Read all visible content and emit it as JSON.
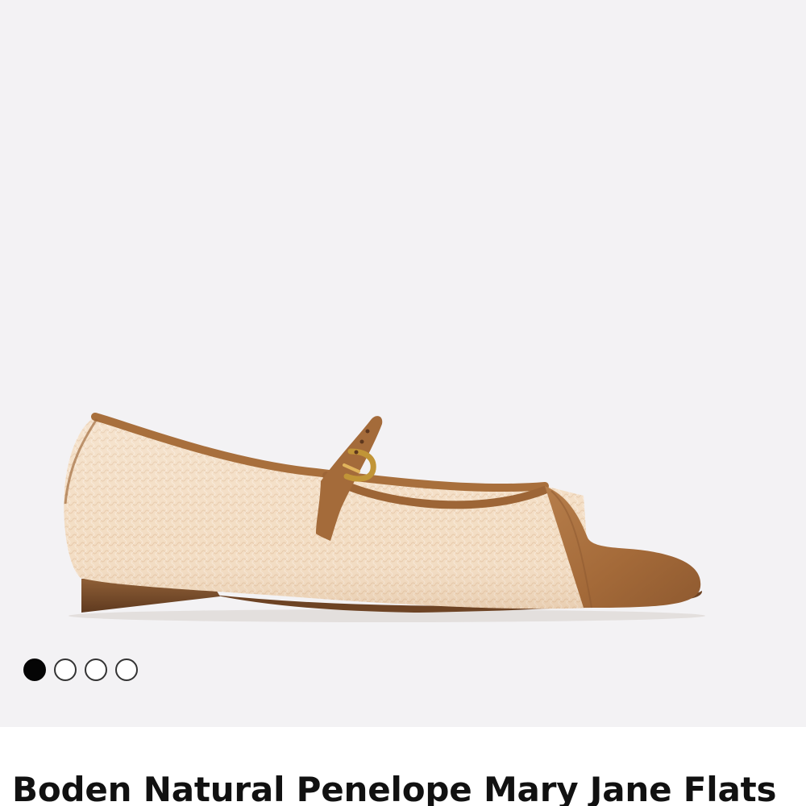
{
  "product": {
    "title": "Boden Natural Penelope Mary Jane Flats",
    "image_alt": "Mary Jane flat shoe with woven raffia body and tan suede toe cap"
  },
  "carousel": {
    "total_images": 4,
    "active_index": 0
  },
  "colors": {
    "gallery_background": "#f3f2f4",
    "raffia": "#f3ddc3",
    "suede": "#a87040",
    "active_dot": "#050505"
  }
}
